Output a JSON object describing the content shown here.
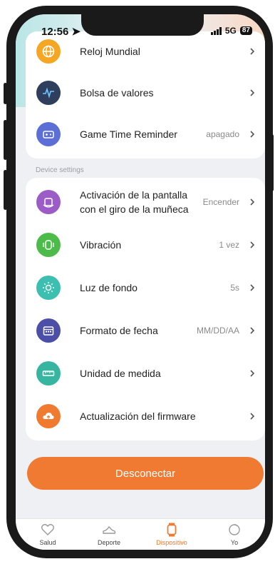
{
  "status_bar": {
    "time": "12:56",
    "network": "5G",
    "battery": "87"
  },
  "top_card": {
    "items": [
      {
        "label": "Reloj Mundial",
        "icon": "globe-icon",
        "color": "#f5a623"
      },
      {
        "label": "Bolsa de valores",
        "icon": "stock-chart-icon",
        "color": "#2f3e5c"
      },
      {
        "label": "Game Time Reminder",
        "value": "apagado",
        "icon": "game-console-icon",
        "color": "#5b6fd6"
      }
    ]
  },
  "section_title": "Device settings",
  "device_card": {
    "items": [
      {
        "label": "Activación de la pantalla",
        "label2": "con el giro de la muñeca",
        "value": "Encender",
        "icon": "wrist-raise-icon",
        "color": "#9b5cc7"
      },
      {
        "label": "Vibración",
        "value": "1 vez",
        "icon": "vibration-icon",
        "color": "#4cbb4a"
      },
      {
        "label": "Luz de fondo",
        "value": "5s",
        "icon": "sun-icon",
        "color": "#3cbfb0"
      },
      {
        "label": "Formato de fecha",
        "value": "MM/DD/AA",
        "icon": "calendar-icon",
        "color": "#4b4fa8"
      },
      {
        "label": "Unidad de medida",
        "icon": "ruler-icon",
        "color": "#36b6a0"
      },
      {
        "label": "Actualización del firmware",
        "icon": "cloud-upload-icon",
        "color": "#f07a2f"
      }
    ]
  },
  "disconnect_button": "Desconectar",
  "tabs": [
    {
      "label": "Salud",
      "icon": "heart-icon",
      "active": false
    },
    {
      "label": "Deporte",
      "icon": "shoe-icon",
      "active": false
    },
    {
      "label": "Dispositivo",
      "icon": "watch-icon",
      "active": true
    },
    {
      "label": "Yo",
      "icon": "profile-icon",
      "active": false
    }
  ],
  "accent_color": "#f17a32"
}
